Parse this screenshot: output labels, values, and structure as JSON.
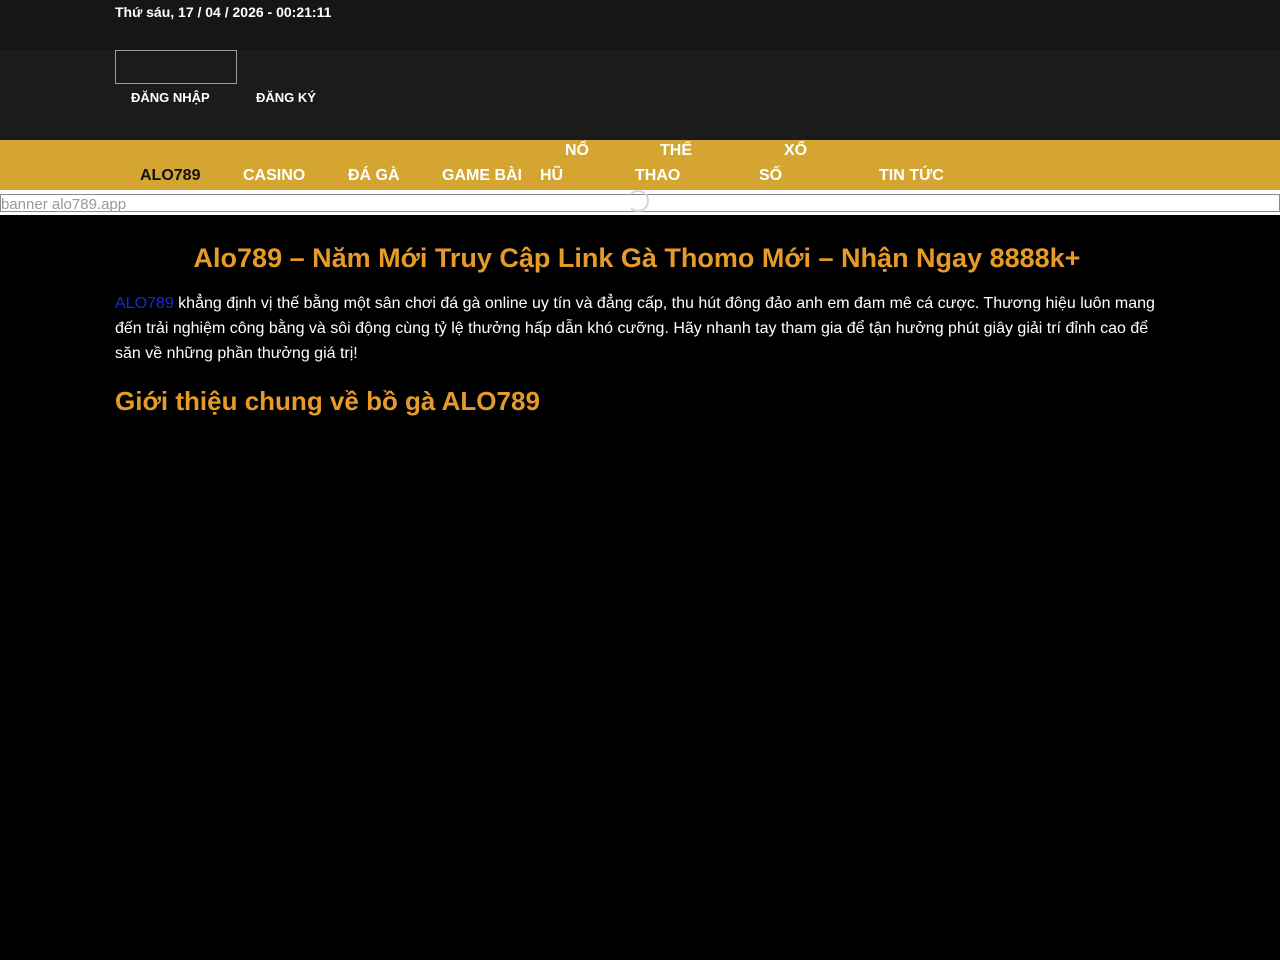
{
  "topbar": {
    "datetime": "Thứ sáu, 17 / 04 / 2026 - 00:21:11"
  },
  "header": {
    "login_label": "ĐĂNG NHẬP",
    "register_label": "ĐĂNG KÝ"
  },
  "nav": {
    "items": [
      {
        "label": "ALO789"
      },
      {
        "label": "CASINO"
      },
      {
        "label": "ĐÁ GÀ"
      },
      {
        "label": "GAME BÀI"
      },
      {
        "line1": "NỔ",
        "line2": "HŨ"
      },
      {
        "line1": "THỂ",
        "line2": "THAO"
      },
      {
        "line1": "XỔ",
        "line2": "SỐ"
      },
      {
        "label": "TIN TỨC"
      }
    ]
  },
  "banner": {
    "alt": "banner alo789.app"
  },
  "article": {
    "title": "Alo789 – Năm Mới Truy Cập Link Gà Thomo Mới – Nhận Ngay 8888k+",
    "intro_link": "ALO789",
    "intro_text": " khẳng định vị thế bằng một sân chơi đá gà online uy tín và đẳng cấp, thu hút đông đảo anh em đam mê cá cược. Thương hiệu luôn mang đến trải nghiệm công bằng và sôi động cùng tỷ lệ thưởng hấp dẫn khó cưỡng. Hãy nhanh tay tham gia để tận hưởng phút giây giải trí đỉnh cao để săn về những phần thưởng giá trị!",
    "section_title": "Giới thiệu chung về bồ gà ALO789"
  },
  "colors": {
    "nav_bg": "#d4a631",
    "heading": "#e69a2a",
    "link": "#1a2bd6",
    "page_bg": "#000000"
  }
}
